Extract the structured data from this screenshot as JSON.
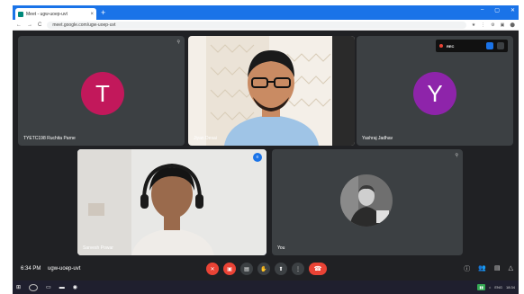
{
  "browser": {
    "tab_title": "Meet - ugw-uoep-uvt",
    "tab_close": "×",
    "new_tab": "+",
    "url": "meet.google.com/ugw-uoep-uvt",
    "nav_back": "←",
    "nav_forward": "→",
    "nav_reload": "C",
    "window_controls": [
      "–",
      "▢",
      "✕"
    ],
    "extension_icons": [
      "★",
      "⋮",
      "⚙",
      "▣",
      "⬤"
    ]
  },
  "meet": {
    "participants": [
      {
        "name": "TYETC198 Ruchita Parne",
        "initial": "T",
        "avatar_color": "#c2185b"
      },
      {
        "name": "Jiyan Desai",
        "initial": "",
        "avatar_color": ""
      },
      {
        "name": "Yashraj Jadhav",
        "initial": "Y",
        "avatar_color": "#8e24aa"
      },
      {
        "name": "Sarvesh Powar",
        "initial": "",
        "avatar_color": ""
      },
      {
        "name": "You",
        "initial": "",
        "avatar_color": ""
      }
    ],
    "recording_label": "REC",
    "time": "6:34 PM",
    "meeting_code": "ugw-uoep-uvt"
  },
  "controls": {
    "mic_icon": "mic-off-icon",
    "cam_icon": "camera-off-icon",
    "captions_icon": "captions-icon",
    "hand_icon": "raise-hand-icon",
    "present_icon": "present-icon",
    "more_icon": "more-icon",
    "end_call_icon": "end-call-icon"
  },
  "taskbar": {
    "search_label": "Search",
    "tray_wifi": "⌂",
    "tray_lang": "ENG",
    "tray_time": "18:34",
    "tray_date": "11-06-2021"
  }
}
